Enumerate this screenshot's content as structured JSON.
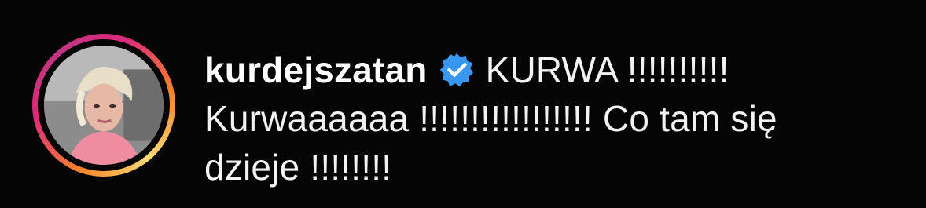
{
  "comment": {
    "username": "kurdejszatan",
    "verified": true,
    "text_line1": "KURWA !!!!!!!!!!",
    "text_line2": "Kurwaaaaaa !!!!!!!!!!!!!!!!! Co tam się",
    "text_line3": "dzieje !!!!!!!!"
  },
  "colors": {
    "background": "#050505",
    "text": "#f2f2f2",
    "verified_badge": "#3897f0",
    "story_ring_start": "#f58529",
    "story_ring_end": "#dd2a7b"
  },
  "icons": {
    "verified": "verified-badge-icon",
    "avatar": "profile-avatar"
  }
}
